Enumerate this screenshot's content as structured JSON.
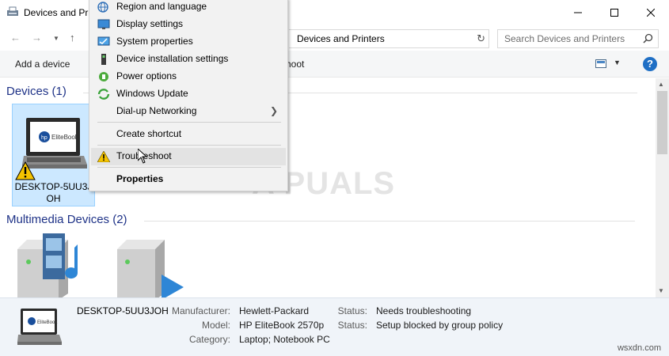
{
  "window": {
    "title": "Devices and Pri",
    "minimize_icon": "minimize-icon",
    "maximize_icon": "maximize-icon",
    "close_icon": "close-icon"
  },
  "address_bar": {
    "breadcrumb": "Devices and Printers",
    "search_placeholder": "Search Devices and Printers"
  },
  "command_bar": {
    "add_device": "Add a device",
    "troubleshoot_partial": "shoot"
  },
  "groups": [
    {
      "title": "Devices (1)"
    },
    {
      "title": "Multimedia Devices (2)"
    }
  ],
  "device": {
    "label": "DESKTOP-5UU3J OH",
    "label_line1": "DESKTOP-5UU3J",
    "label_line2": "OH",
    "screen_brand": "EliteBook"
  },
  "context_menu": {
    "items": [
      {
        "label": "Region and language",
        "icon": "region-language-icon"
      },
      {
        "label": "Display settings",
        "icon": "display-icon"
      },
      {
        "label": "System properties",
        "icon": "system-properties-icon"
      },
      {
        "label": "Device installation settings",
        "icon": "device-installation-icon"
      },
      {
        "label": "Power options",
        "icon": "power-options-icon"
      },
      {
        "label": "Windows Update",
        "icon": "windows-update-icon"
      },
      {
        "label": "Dial-up Networking",
        "icon": "",
        "submenu": true
      },
      {
        "label": "Create shortcut"
      },
      {
        "label": "Troubleshoot",
        "icon": "warning-icon",
        "highlighted": true
      },
      {
        "label": "Properties",
        "bold": true
      }
    ]
  },
  "watermark": "A  PUALS",
  "details": {
    "device_name": "DESKTOP-5UU3JOH",
    "manufacturer_label": "Manufacturer:",
    "manufacturer": "Hewlett-Packard",
    "model_label": "Model:",
    "model": "HP EliteBook 2570p",
    "category_label": "Category:",
    "category": "Laptop; Notebook PC",
    "status_label_1": "Status:",
    "status_1": "Needs troubleshooting",
    "status_label_2": "Status:",
    "status_2": "Setup blocked by group policy"
  },
  "site_watermark": "wsxdn.com",
  "colors": {
    "selection": "#cce8ff",
    "group_header": "#1e3287",
    "details_bg": "#f0f4f9",
    "accent": "#1f6fc5",
    "warning": "#f5c400"
  }
}
